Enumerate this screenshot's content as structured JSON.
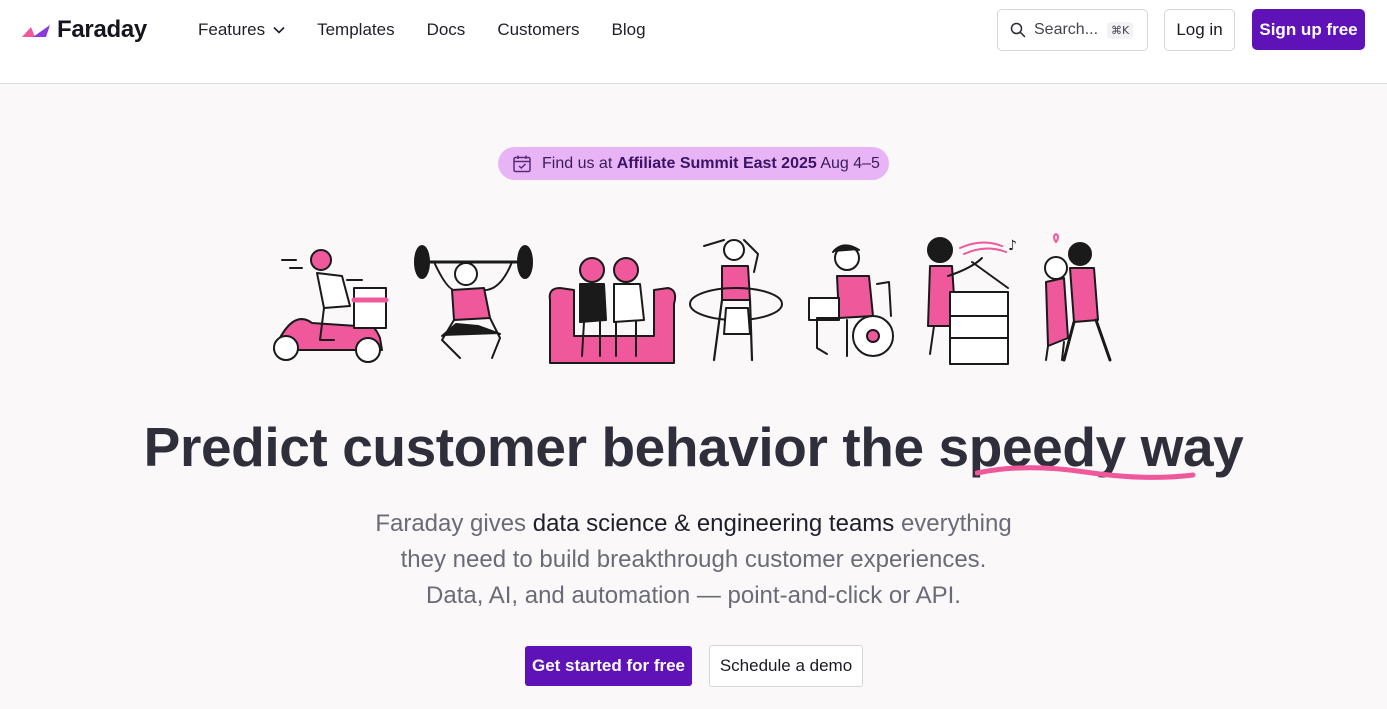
{
  "brand": {
    "name": "Faraday",
    "accent": "#5e12b8",
    "pink": "#f0589c",
    "pill_bg": "#e9b4f5"
  },
  "nav": {
    "items": [
      {
        "label": "Features",
        "has_dropdown": true
      },
      {
        "label": "Templates"
      },
      {
        "label": "Docs"
      },
      {
        "label": "Customers"
      },
      {
        "label": "Blog"
      }
    ]
  },
  "search": {
    "label": "Search...",
    "shortcut": "⌘K"
  },
  "auth": {
    "login_label": "Log in",
    "signup_label": "Sign up free"
  },
  "announcement": {
    "prefix": "Find us at ",
    "event": "Affiliate Summit East 2025",
    "dates": " Aug 4–5",
    "icon": "calendar-icon"
  },
  "illustrations": [
    "scooter-delivery",
    "weightlifter",
    "couple-on-couch",
    "hula-hoop",
    "wheelchair-laptop",
    "copy-machine",
    "dancing-couple"
  ],
  "hero": {
    "headline": "Predict customer behavior the speedy way",
    "sub_prefix": "Faraday gives ",
    "sub_bold": "data science & engineering teams",
    "sub_line1_suffix": " everything",
    "sub_line2": "they need to build breakthrough customer experiences.",
    "sub_line3": "Data, AI, and automation — point-and-click or API.",
    "cta_primary": "Get started for free",
    "cta_secondary": "Schedule a demo"
  }
}
